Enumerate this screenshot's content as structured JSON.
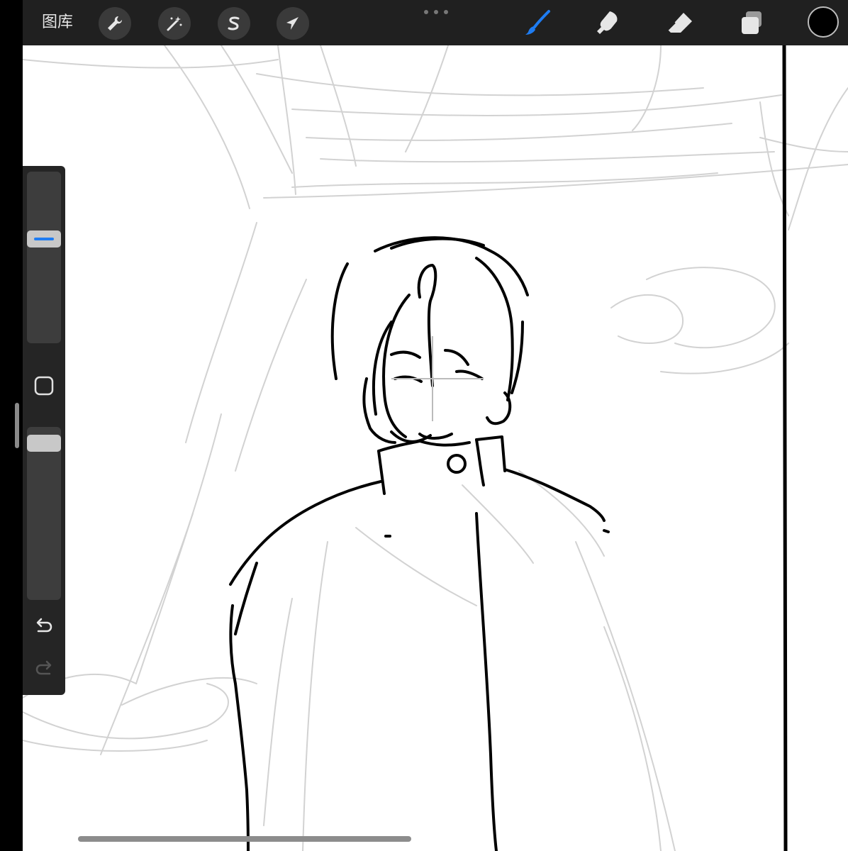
{
  "toolbar": {
    "gallery_label": "图库",
    "left_tools": [
      {
        "name": "actions",
        "icon": "wrench-icon"
      },
      {
        "name": "adjustments",
        "icon": "magic-wand-icon"
      },
      {
        "name": "selection",
        "icon": "selection-s-icon"
      },
      {
        "name": "transform",
        "icon": "arrow-cursor-icon"
      }
    ],
    "right_tools": [
      {
        "name": "brush",
        "icon": "brush-icon",
        "active": true
      },
      {
        "name": "smudge",
        "icon": "smudge-icon",
        "active": false
      },
      {
        "name": "eraser",
        "icon": "eraser-icon",
        "active": false
      },
      {
        "name": "layers",
        "icon": "layers-icon",
        "active": false
      }
    ],
    "active_color": "#000000",
    "accent_color": "#1e7cf2"
  },
  "sidebar": {
    "brush_size_level": 0.3,
    "brush_opacity_level": 0.95,
    "buttons": [
      "modify-icon",
      "undo-icon",
      "redo-icon"
    ],
    "redo_enabled": false
  }
}
